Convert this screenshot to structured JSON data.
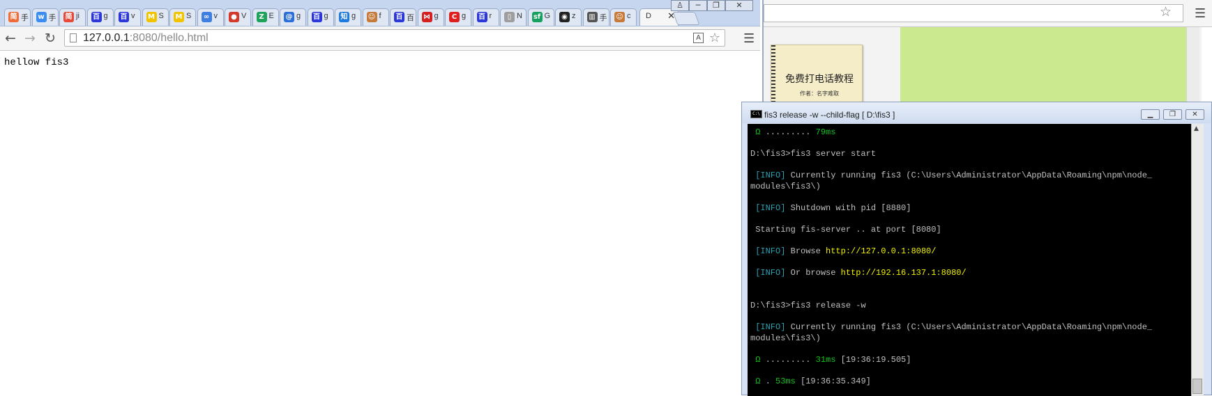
{
  "left_browser": {
    "tabs": [
      {
        "title": "手",
        "icon": "jianshu-icon",
        "color": "#f06d3a",
        "glyph": "简"
      },
      {
        "title": "手",
        "icon": "w-icon",
        "color": "#3b8ef0",
        "glyph": "w"
      },
      {
        "title": "ji",
        "icon": "jian-icon",
        "color": "#e84a3a",
        "glyph": "简"
      },
      {
        "title": "g",
        "icon": "baidu-icon",
        "color": "#2b37d8",
        "glyph": "百"
      },
      {
        "title": "v",
        "icon": "baidu-icon",
        "color": "#2b37d8",
        "glyph": "百"
      },
      {
        "title": "S",
        "icon": "mc-icon",
        "color": "#f2c400",
        "glyph": "M"
      },
      {
        "title": "S",
        "icon": "mc-icon",
        "color": "#f2c400",
        "glyph": "M"
      },
      {
        "title": "v",
        "icon": "cloud-icon",
        "color": "#3f7fe0",
        "glyph": "∞"
      },
      {
        "title": "V",
        "icon": "circle-icon",
        "color": "#d33a2c",
        "glyph": "●"
      },
      {
        "title": "E",
        "icon": "z-icon",
        "color": "#1fa35a",
        "glyph": "Z"
      },
      {
        "title": "g",
        "icon": "at-icon",
        "color": "#2c6fd8",
        "glyph": "@"
      },
      {
        "title": "g",
        "icon": "baidu-icon",
        "color": "#2b37d8",
        "glyph": "百"
      },
      {
        "title": "g",
        "icon": "zhihu-icon",
        "color": "#1f7ae0",
        "glyph": "知"
      },
      {
        "title": "f",
        "icon": "monkey-icon",
        "color": "#c77b3b",
        "glyph": "☺"
      },
      {
        "title": "百",
        "icon": "baidu-icon",
        "color": "#2b37d8",
        "glyph": "百"
      },
      {
        "title": "g",
        "icon": "bow-icon",
        "color": "#d61f1f",
        "glyph": "⋈"
      },
      {
        "title": "g",
        "icon": "c-icon",
        "color": "#e02020",
        "glyph": "C"
      },
      {
        "title": "r",
        "icon": "baidu-icon",
        "color": "#2b37d8",
        "glyph": "百"
      },
      {
        "title": "N",
        "icon": "page-icon",
        "color": "#9e9e9e",
        "glyph": "▯"
      },
      {
        "title": "G",
        "icon": "sf-icon",
        "color": "#17a05e",
        "glyph": "sf"
      },
      {
        "title": "z",
        "icon": "github-icon",
        "color": "#222222",
        "glyph": "◉"
      },
      {
        "title": "手",
        "icon": "book-icon",
        "color": "#555555",
        "glyph": "▥"
      },
      {
        "title": "c",
        "icon": "monkey-icon",
        "color": "#c77b3b",
        "glyph": "☺"
      }
    ],
    "active_tab": {
      "title": "D",
      "close": "✕"
    },
    "url_host": "127.0.0.1",
    "url_rest": ":8080/hello.html",
    "page_text": "hellow fis3"
  },
  "right_browser": {
    "book_title": "免费打电话教程",
    "book_author": "作者：名字难取"
  },
  "console": {
    "title": "fis3 release -w --child-flag [ D:\\fis3 ]",
    "lines": [
      [
        {
          "t": " Ω ",
          "c": "g"
        },
        {
          "t": "......... ",
          "c": "w"
        },
        {
          "t": "79ms",
          "c": "g"
        }
      ],
      [
        {
          "t": "D:\\fis3>fis3 server start",
          "c": "w"
        }
      ],
      [
        {
          "t": " [INFO]",
          "c": "c"
        },
        {
          "t": " Currently running fis3 (C:\\Users\\Administrator\\AppData\\Roaming\\npm\\node_",
          "c": "w"
        }
      ],
      [
        {
          "t": "modules\\fis3\\)",
          "c": "w"
        }
      ],
      [
        {
          "t": " [INFO]",
          "c": "c"
        },
        {
          "t": " Shutdown with pid [8880]",
          "c": "w"
        }
      ],
      [
        {
          "t": " Starting fis-server .. at port [8080]",
          "c": "w"
        }
      ],
      [
        {
          "t": " [INFO]",
          "c": "c"
        },
        {
          "t": " Browse ",
          "c": "w"
        },
        {
          "t": "http://127.0.0.1:8080/",
          "c": "y"
        }
      ],
      [
        {
          "t": " [INFO]",
          "c": "c"
        },
        {
          "t": " Or browse ",
          "c": "w"
        },
        {
          "t": "http://192.16.137.1:8080/",
          "c": "y"
        }
      ],
      [
        {
          "t": "D:\\fis3>fis3 release -w",
          "c": "w"
        }
      ],
      [
        {
          "t": " [INFO]",
          "c": "c"
        },
        {
          "t": " Currently running fis3 (C:\\Users\\Administrator\\AppData\\Roaming\\npm\\node_",
          "c": "w"
        }
      ],
      [
        {
          "t": "modules\\fis3\\)",
          "c": "w"
        }
      ],
      [
        {
          "t": " Ω ",
          "c": "g"
        },
        {
          "t": "......... ",
          "c": "w"
        },
        {
          "t": "31ms",
          "c": "g"
        },
        {
          "t": " [19:36:19.505]",
          "c": "w"
        }
      ],
      [
        {
          "t": " Ω ",
          "c": "g"
        },
        {
          "t": ". ",
          "c": "w"
        },
        {
          "t": "53ms",
          "c": "g"
        },
        {
          "t": " [19:36:35.349]",
          "c": "w"
        }
      ]
    ]
  }
}
